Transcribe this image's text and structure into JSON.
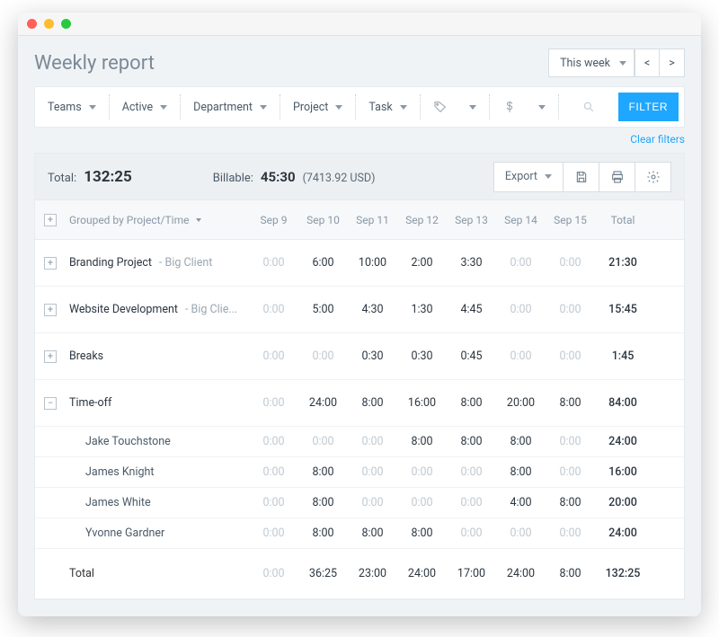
{
  "header": {
    "title": "Weekly report",
    "range_label": "This week",
    "prev_symbol": "<",
    "next_symbol": ">"
  },
  "filters": {
    "teams": "Teams",
    "active": "Active",
    "department": "Department",
    "project": "Project",
    "task": "Task",
    "button": "FILTER",
    "clear": "Clear filters",
    "search_placeholder": ""
  },
  "summary": {
    "total_label": "Total:",
    "total_value": "132:25",
    "billable_label": "Billable:",
    "billable_value": "45:30",
    "currency": "(7413.92 USD)",
    "export_label": "Export"
  },
  "columns": {
    "group_label": "Grouped by Project/Time",
    "days": [
      "Sep 9",
      "Sep 10",
      "Sep 11",
      "Sep 12",
      "Sep 13",
      "Sep 14",
      "Sep 15"
    ],
    "total_label": "Total"
  },
  "rows": [
    {
      "expand": "plus",
      "name": "Branding Project",
      "suffix": " - Big Client",
      "cells": [
        {
          "v": "0:00",
          "dim": true
        },
        {
          "v": "6:00"
        },
        {
          "v": "10:00"
        },
        {
          "v": "2:00"
        },
        {
          "v": "3:30"
        },
        {
          "v": "0:00",
          "dim": true
        },
        {
          "v": "0:00",
          "dim": true
        }
      ],
      "total": "21:30"
    },
    {
      "expand": "plus",
      "name": "Website Development",
      "suffix": " - Big Clie...",
      "cells": [
        {
          "v": "0:00",
          "dim": true
        },
        {
          "v": "5:00"
        },
        {
          "v": "4:30"
        },
        {
          "v": "1:30"
        },
        {
          "v": "4:45"
        },
        {
          "v": "0:00",
          "dim": true
        },
        {
          "v": "0:00",
          "dim": true
        }
      ],
      "total": "15:45"
    },
    {
      "expand": "plus",
      "name": "Breaks",
      "suffix": "",
      "cells": [
        {
          "v": "0:00",
          "dim": true
        },
        {
          "v": "0:00",
          "dim": true
        },
        {
          "v": "0:30"
        },
        {
          "v": "0:30"
        },
        {
          "v": "0:45"
        },
        {
          "v": "0:00",
          "dim": true
        },
        {
          "v": "0:00",
          "dim": true
        }
      ],
      "total": "1:45"
    },
    {
      "expand": "minus",
      "name": "Time-off",
      "suffix": "",
      "cells": [
        {
          "v": "0:00",
          "dim": true
        },
        {
          "v": "24:00"
        },
        {
          "v": "8:00"
        },
        {
          "v": "16:00"
        },
        {
          "v": "8:00"
        },
        {
          "v": "20:00"
        },
        {
          "v": "8:00"
        }
      ],
      "total": "84:00",
      "children": [
        {
          "name": "Jake Touchstone",
          "cells": [
            {
              "v": "0:00",
              "dim": true
            },
            {
              "v": "0:00",
              "dim": true
            },
            {
              "v": "0:00",
              "dim": true
            },
            {
              "v": "8:00"
            },
            {
              "v": "8:00"
            },
            {
              "v": "8:00"
            },
            {
              "v": "0:00",
              "dim": true
            }
          ],
          "total": "24:00"
        },
        {
          "name": "James Knight",
          "cells": [
            {
              "v": "0:00",
              "dim": true
            },
            {
              "v": "8:00"
            },
            {
              "v": "0:00",
              "dim": true
            },
            {
              "v": "0:00",
              "dim": true
            },
            {
              "v": "0:00",
              "dim": true
            },
            {
              "v": "8:00"
            },
            {
              "v": "0:00",
              "dim": true
            }
          ],
          "total": "16:00"
        },
        {
          "name": "James White",
          "cells": [
            {
              "v": "0:00",
              "dim": true
            },
            {
              "v": "8:00"
            },
            {
              "v": "0:00",
              "dim": true
            },
            {
              "v": "0:00",
              "dim": true
            },
            {
              "v": "0:00",
              "dim": true
            },
            {
              "v": "4:00"
            },
            {
              "v": "8:00"
            }
          ],
          "total": "20:00"
        },
        {
          "name": "Yvonne Gardner",
          "cells": [
            {
              "v": "0:00",
              "dim": true
            },
            {
              "v": "8:00"
            },
            {
              "v": "8:00"
            },
            {
              "v": "8:00"
            },
            {
              "v": "0:00",
              "dim": true
            },
            {
              "v": "0:00",
              "dim": true
            },
            {
              "v": "0:00",
              "dim": true
            }
          ],
          "total": "24:00"
        }
      ]
    }
  ],
  "footer": {
    "label": "Total",
    "cells": [
      {
        "v": "0:00",
        "dim": true
      },
      {
        "v": "36:25"
      },
      {
        "v": "23:00"
      },
      {
        "v": "24:00"
      },
      {
        "v": "17:00"
      },
      {
        "v": "24:00"
      },
      {
        "v": "8:00"
      }
    ],
    "total": "132:25"
  }
}
